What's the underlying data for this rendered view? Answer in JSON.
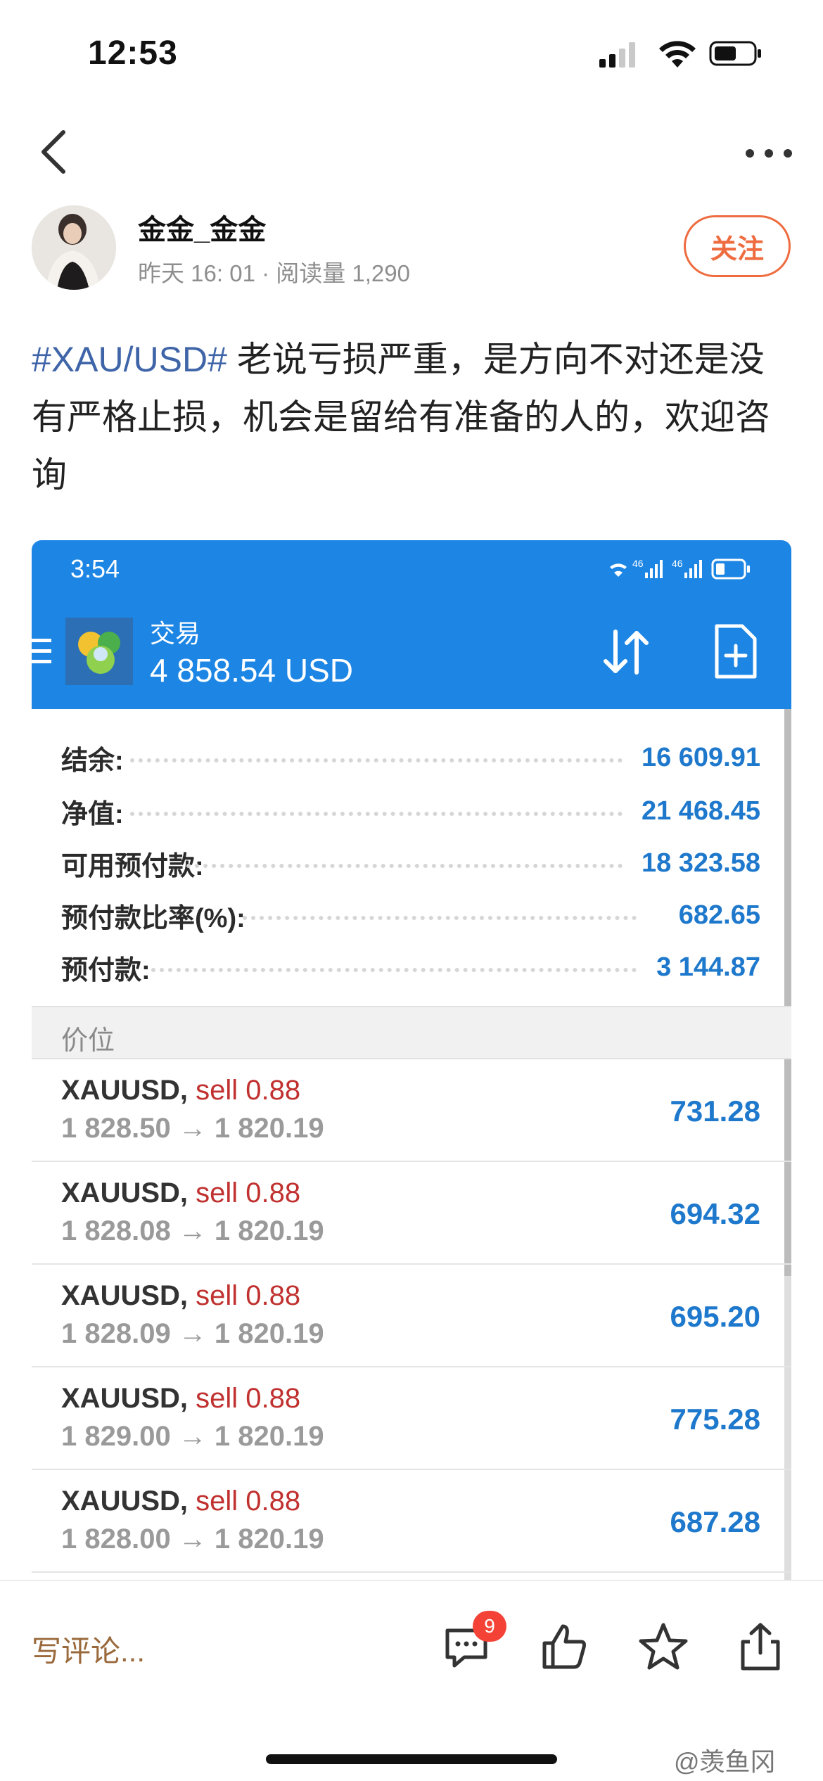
{
  "status_bar": {
    "time": "12:53"
  },
  "author": {
    "name": "金金_金金",
    "meta": "昨天 16: 01 · 阅读量 1,290",
    "follow_label": "关注"
  },
  "post": {
    "tag": "#XAU/USD#",
    "text": " 老说亏损严重，是方向不对还是没有严格止损，机会是留给有准备的人的，欢迎咨询"
  },
  "embedded": {
    "time": "3:54",
    "title": "交易",
    "balance": "4 858.54 USD",
    "summary": [
      {
        "label": "结余:",
        "value": "16 609.91"
      },
      {
        "label": "净值:",
        "value": "21 468.45"
      },
      {
        "label": "可用预付款:",
        "value": "18 323.58"
      },
      {
        "label": "预付款比率(%):",
        "value": "682.65"
      },
      {
        "label": "预付款:",
        "value": "3 144.87"
      }
    ],
    "section_label": "价位",
    "trades": [
      {
        "symbol": "XAUUSD,",
        "side": "sell 0.88",
        "prices": "1 828.50 → 1 820.19",
        "profit": "731.28"
      },
      {
        "symbol": "XAUUSD,",
        "side": "sell 0.88",
        "prices": "1 828.08 → 1 820.19",
        "profit": "694.32"
      },
      {
        "symbol": "XAUUSD,",
        "side": "sell 0.88",
        "prices": "1 828.09 → 1 820.19",
        "profit": "695.20"
      },
      {
        "symbol": "XAUUSD,",
        "side": "sell 0.88",
        "prices": "1 829.00 → 1 820.19",
        "profit": "775.28"
      },
      {
        "symbol": "XAUUSD,",
        "side": "sell 0.88",
        "prices": "1 828.00 → 1 820.19",
        "profit": "687.28"
      }
    ]
  },
  "bottom_bar": {
    "comment_placeholder": "写评论...",
    "comment_count": "9"
  },
  "watermark": "@羡鱼冈",
  "icons": {
    "back": "chevron-left-icon",
    "more": "more-dots-icon",
    "comment": "comment-icon",
    "like": "thumbs-up-icon",
    "favorite": "star-icon",
    "share": "share-icon"
  },
  "colors": {
    "accent": "#ee6c3f",
    "tag": "#3f65a8",
    "app_header": "#1d86e5",
    "profit": "#1e78cc",
    "sell": "#c0312f"
  }
}
